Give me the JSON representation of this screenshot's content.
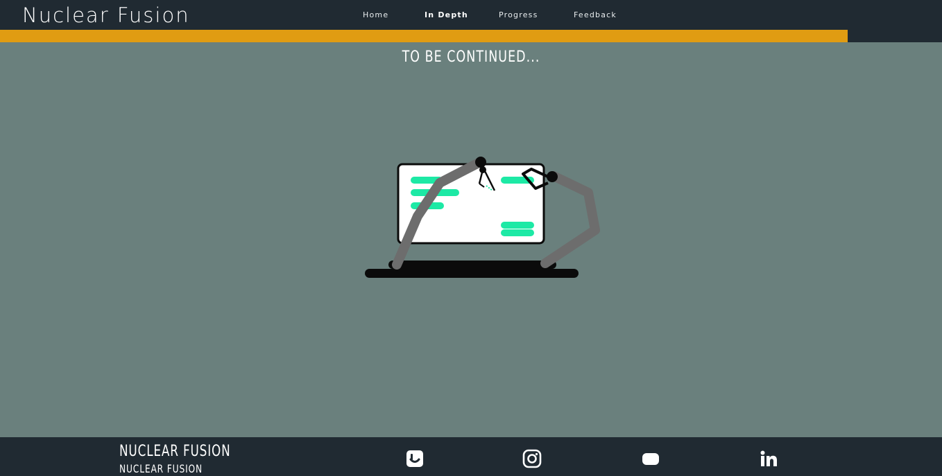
{
  "header": {
    "brand": "Nuclear Fusion",
    "nav": [
      {
        "label": "Home",
        "active": false
      },
      {
        "label": "In Depth",
        "active": true
      },
      {
        "label": "Progress",
        "active": false
      },
      {
        "label": "Feedback",
        "active": false
      }
    ],
    "scroll_progress_percent": 90
  },
  "main": {
    "title": "TO BE CONTINUED...",
    "illustration": "robot-arms-building-webpage-illustration"
  },
  "footer": {
    "title": "NUCLEAR FUSION",
    "subtitle": "NUCLEAR FUSION",
    "social": [
      {
        "name": "skype-icon"
      },
      {
        "name": "instagram-icon"
      },
      {
        "name": "youtube-icon"
      },
      {
        "name": "linkedin-icon"
      }
    ]
  },
  "colors": {
    "header_bg": "#202a32",
    "page_bg": "#6a807d",
    "accent": "#e09c12",
    "illustration_green": "#1de9a5"
  }
}
